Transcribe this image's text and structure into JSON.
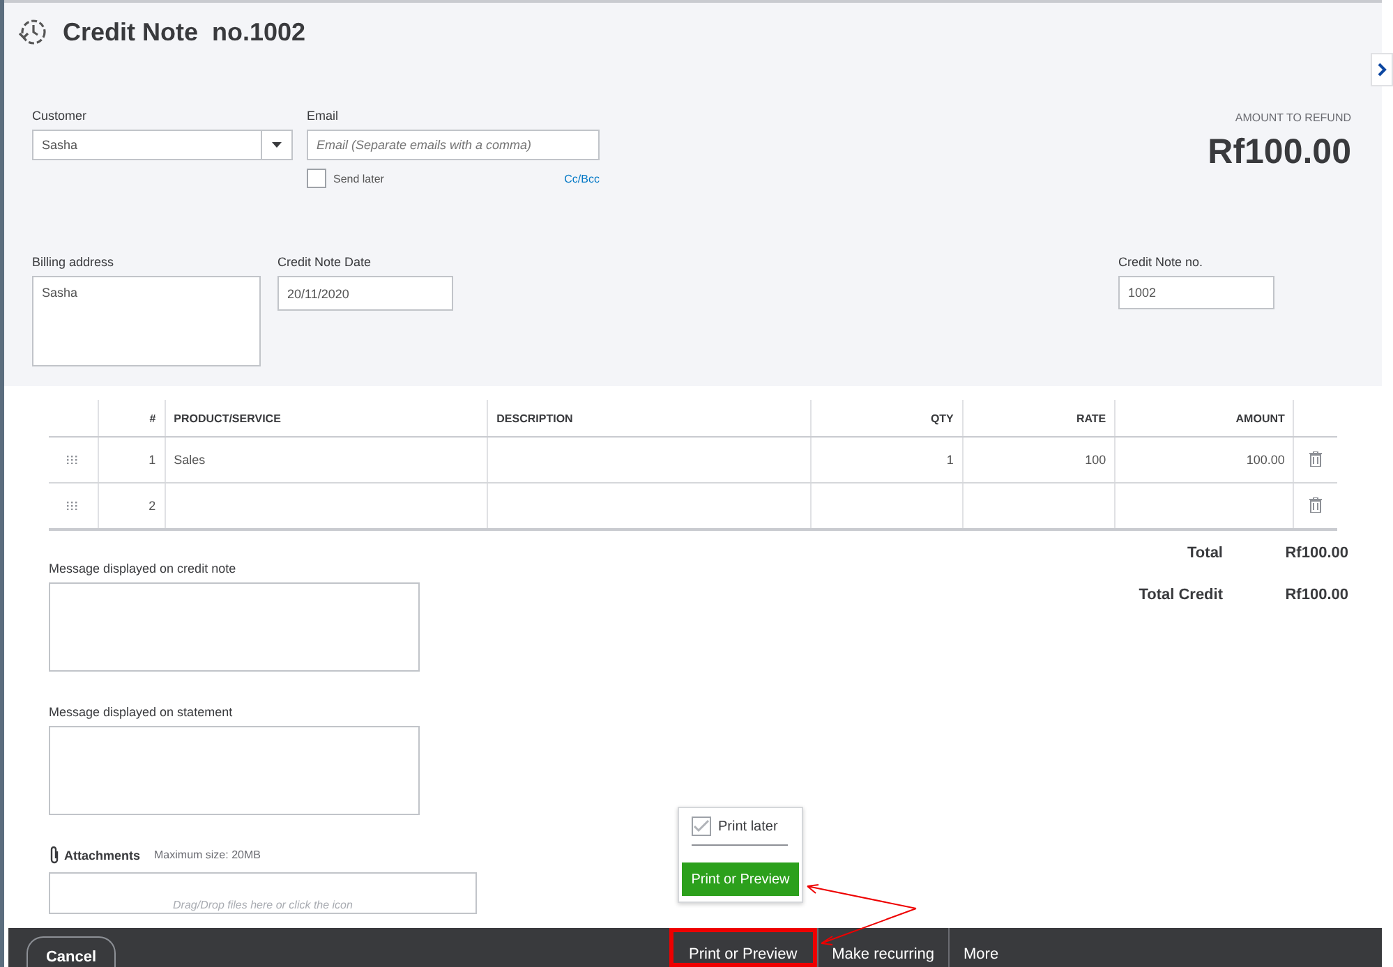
{
  "header": {
    "title": "Credit Note  no.1002"
  },
  "customer": {
    "label": "Customer",
    "value": "Sasha"
  },
  "email": {
    "label": "Email",
    "placeholder": "Email (Separate emails with a comma)",
    "send_later": {
      "label": "Send later",
      "checked": false
    },
    "cc_bcc": "Cc/Bcc"
  },
  "amount": {
    "label": "AMOUNT TO REFUND",
    "value": "Rf100.00"
  },
  "billing_address": {
    "label": "Billing address",
    "value": "Sasha"
  },
  "date": {
    "label": "Credit Note Date",
    "value": "20/11/2020"
  },
  "number": {
    "label": "Credit Note no.",
    "value": "1002"
  },
  "table": {
    "columns": [
      "#",
      "PRODUCT/SERVICE",
      "DESCRIPTION",
      "QTY",
      "RATE",
      "AMOUNT"
    ],
    "rows": [
      {
        "num": "1",
        "product": "Sales",
        "description": "",
        "qty": "1",
        "rate": "100",
        "amount": "100.00"
      },
      {
        "num": "2",
        "product": "",
        "description": "",
        "qty": "",
        "rate": "",
        "amount": ""
      }
    ]
  },
  "totals": [
    {
      "label": "Total",
      "value": "Rf100.00"
    },
    {
      "label": "Total Credit",
      "value": "Rf100.00"
    }
  ],
  "messages": [
    {
      "label": "Message displayed on credit note"
    },
    {
      "label": "Message displayed on statement"
    }
  ],
  "attachments": {
    "label": "Attachments",
    "hint": "Maximum size: 20MB",
    "drop": "Drag/Drop files here or click the icon"
  },
  "popover": {
    "print_later": {
      "label": "Print later",
      "checked": true
    },
    "button": "Print or Preview"
  },
  "footer": {
    "cancel": "Cancel",
    "actions": [
      {
        "label": "Print or Preview",
        "highlighted": true
      },
      {
        "label": "Make recurring",
        "highlighted": false
      },
      {
        "label": "More",
        "highlighted": false
      }
    ]
  }
}
